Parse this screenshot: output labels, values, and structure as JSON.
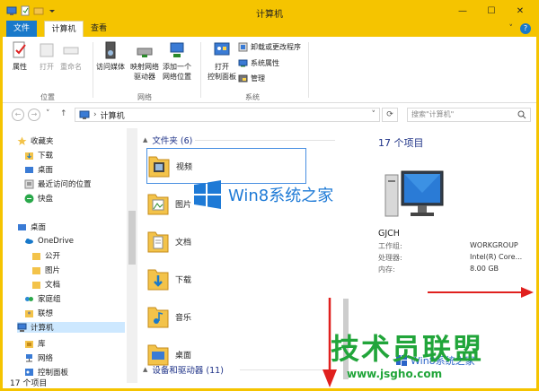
{
  "window": {
    "title": "计算机",
    "minimize": "—",
    "maximize": "☐",
    "close": "✕"
  },
  "ribbon_tabs": {
    "file": "文件",
    "computer": "计算机",
    "view": "查看"
  },
  "ribbon": {
    "location": {
      "label": "位置",
      "properties": "属性",
      "open": "打开",
      "rename": "重命名"
    },
    "network": {
      "label": "网络",
      "access_media": "访问媒体",
      "map_drive": "映射网络\n驱动器",
      "add_location": "添加一个\n网络位置"
    },
    "system": {
      "label": "系统",
      "open_control_panel": "打开\n控制面板",
      "uninstall": "卸载或更改程序",
      "system_properties": "系统属性",
      "manage": "管理"
    }
  },
  "navbar": {
    "breadcrumb": "计算机",
    "search_placeholder": "搜索\"计算机\""
  },
  "navpane": {
    "items": [
      {
        "label": "收藏夹",
        "icon": "star-icon"
      },
      {
        "label": "下载",
        "icon": "download-folder-icon"
      },
      {
        "label": "桌面",
        "icon": "desktop-icon"
      },
      {
        "label": "最近访问的位置",
        "icon": "recent-icon"
      },
      {
        "label": "快盘",
        "icon": "kuaipan-icon"
      },
      {
        "label": "桌面",
        "icon": "desktop-icon"
      },
      {
        "label": "OneDrive",
        "icon": "cloud-icon"
      },
      {
        "label": "公开",
        "icon": "folder-icon"
      },
      {
        "label": "图片",
        "icon": "folder-icon"
      },
      {
        "label": "文档",
        "icon": "folder-icon"
      },
      {
        "label": "家庭组",
        "icon": "homegroup-icon"
      },
      {
        "label": "联想",
        "icon": "user-folder-icon"
      },
      {
        "label": "计算机",
        "icon": "computer-icon"
      },
      {
        "label": "库",
        "icon": "library-icon"
      },
      {
        "label": "网络",
        "icon": "network-icon"
      },
      {
        "label": "控制面板",
        "icon": "control-panel-icon"
      }
    ]
  },
  "content": {
    "folders_header": "文件夹 (6)",
    "folders": [
      "视频",
      "图片",
      "文档",
      "下载",
      "音乐",
      "桌面"
    ],
    "devices_header": "设备和驱动器 (11)"
  },
  "details": {
    "count": "17 个项目",
    "pc_name": "GJCH",
    "rows": [
      {
        "key": "工作组:",
        "value": "WORKGROUP"
      },
      {
        "key": "处理器:",
        "value": "Intel(R) Core..."
      },
      {
        "key": "内存:",
        "value": "8.00 GB"
      }
    ]
  },
  "status": {
    "text": "17 个项目"
  },
  "watermarks": {
    "banner": "Win8系统之家",
    "brand": "技术员联盟",
    "url": "www.jsgho.com",
    "small": "Win8系统之家"
  },
  "colors": {
    "titlebar": "#f5c400",
    "accent": "#1979ca",
    "header_text": "#1e3287",
    "watermark_green": "#21a53a",
    "arrow_red": "#e0201e"
  }
}
